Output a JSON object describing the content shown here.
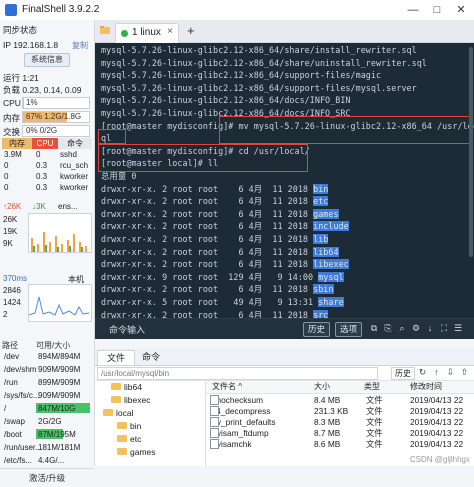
{
  "app": {
    "title": "FinalShell 3.9.2.2",
    "window_buttons": [
      "—",
      "□",
      "✕"
    ]
  },
  "sidebar": {
    "sync_status": "同步状态",
    "ip_label": "IP 192.168.1.8",
    "copy_label": "复制",
    "sysinfo_button": "系统信息",
    "uptime": "运行 1:21",
    "load": "负载 0.23, 0.14, 0.09",
    "cpu": {
      "label": "CPU",
      "text": "1%",
      "percent": 1
    },
    "mem": {
      "label": "内存",
      "text": "67%   1.2G/1.8G",
      "percent": 67
    },
    "swap": {
      "label": "交换",
      "text": "0%   0/2G",
      "percent": 0
    },
    "proc_headers": [
      "内存",
      "CPU",
      "命令"
    ],
    "processes": [
      {
        "mem": "3.9M",
        "cpu": "0",
        "cmd": "sshd"
      },
      {
        "mem": "0",
        "cpu": "0.3",
        "cmd": "rcu_sch"
      },
      {
        "mem": "0",
        "cpu": "0.3",
        "cmd": "kworker"
      },
      {
        "mem": "0",
        "cpu": "0.3",
        "cmd": "kworker"
      }
    ],
    "net": {
      "up": "↑26K",
      "down": "↓3K",
      "iface": "ens...",
      "scale": [
        "26K",
        "19K",
        "9K"
      ]
    },
    "latency": {
      "label": "370ms",
      "host": "本机",
      "scale": [
        "2846",
        "1424",
        "2"
      ]
    },
    "disk_headers": [
      "路径",
      "可用/大小"
    ],
    "disks": [
      {
        "path": "/dev",
        "size": "894M/894M"
      },
      {
        "path": "/dev/shm",
        "size": "909M/909M"
      },
      {
        "path": "/run",
        "size": "899M/909M"
      },
      {
        "path": "/sys/fs/c...",
        "size": "909M/909M"
      },
      {
        "path": "/",
        "size": "847M/10G"
      },
      {
        "path": "/swap",
        "size": "2G/2G"
      },
      {
        "path": "/boot",
        "size": "87M/195M"
      },
      {
        "path": "/run/user...",
        "size": "181M/181M"
      },
      {
        "path": "/etc/fs...",
        "size": "4.4G/..."
      }
    ],
    "upgrade": "激活/升级"
  },
  "tabs": [
    {
      "label": "1 linux"
    }
  ],
  "terminal": {
    "lines": [
      "mysql-5.7.26-linux-glibc2.12-x86_64/share/install_rewriter.sql",
      "mysql-5.7.26-linux-glibc2.12-x86_64/share/uninstall_rewriter.sql",
      "mysql-5.7.26-linux-glibc2.12-x86_64/support-files/magic",
      "mysql-5.7.26-linux-glibc2.12-x86_64/support-files/mysql.server",
      "mysql-5.7.26-linux-glibc2.12-x86_64/docs/INFO_BIN",
      "mysql-5.7.26-linux-glibc2.12-x86_64/docs/INFO_SRC",
      "[root@master mydisconfig]# mv mysql-5.7.26-linux-glibc2.12-x86_64 /usr/local/mys",
      "ql",
      "[root@master mydisconfig]# cd /usr/local/",
      "[root@master local]# ll",
      "总用量 0"
    ],
    "listing": [
      {
        "perm": "drwxr-xr-x. 2 root root    6 4月  11 2018",
        "name": "bin"
      },
      {
        "perm": "drwxr-xr-x. 2 root root    6 4月  11 2018",
        "name": "etc"
      },
      {
        "perm": "drwxr-xr-x. 2 root root    6 4月  11 2018",
        "name": "games"
      },
      {
        "perm": "drwxr-xr-x. 2 root root    6 4月  11 2018",
        "name": "include"
      },
      {
        "perm": "drwxr-xr-x. 2 root root    6 4月  11 2018",
        "name": "lib"
      },
      {
        "perm": "drwxr-xr-x. 2 root root    6 4月  11 2018",
        "name": "lib64"
      },
      {
        "perm": "drwxr-xr-x. 2 root root    6 4月  11 2018",
        "name": "libexec"
      },
      {
        "perm": "drwxr-xr-x. 9 root root  129 4月   9 14:00",
        "name": "mysql"
      },
      {
        "perm": "drwxr-xr-x. 2 root root    6 4月  11 2018",
        "name": "sbin"
      },
      {
        "perm": "drwxr-xr-x. 5 root root   49 4月   9 13:31",
        "name": "share"
      },
      {
        "perm": "drwxr-xr-x. 2 root root    6 4月  11 2018",
        "name": "src"
      }
    ],
    "prompt_end": "[root@master local]# "
  },
  "cmdbar": {
    "label": "命令输入",
    "history": "历史",
    "options": "选项"
  },
  "filepane": {
    "tabs": [
      "文件",
      "命令"
    ],
    "path": "/usr/local/mysql/bin",
    "history_btn": "历史",
    "tree": [
      "lib64",
      "libexec",
      "local",
      "bin",
      "etc",
      "games"
    ],
    "headers": [
      "文件名 ^",
      "大小",
      "类型",
      "修改时间"
    ],
    "files": [
      {
        "name": "innochecksum",
        "size": "8.4 MB",
        "type": "文件",
        "date": "2019/04/13 22"
      },
      {
        "name": "lz4_decompress",
        "size": "231.3 KB",
        "type": "文件",
        "date": "2019/04/13 22"
      },
      {
        "name": "my_print_defaults",
        "size": "8.3 MB",
        "type": "文件",
        "date": "2019/04/13 22"
      },
      {
        "name": "myisam_ftdump",
        "size": "8.7 MB",
        "type": "文件",
        "date": "2019/04/13 22"
      },
      {
        "name": "myisamchk",
        "size": "8.6 MB",
        "type": "文件",
        "date": "2019/04/13 22"
      }
    ],
    "watermark": "CSDN @gljlhhgx"
  },
  "colors": {
    "mem_fill": "#f0b86b",
    "cpu_fill": "#9fd0f0",
    "dir_blue": "#3f7bd6",
    "highlight": "#e2433a"
  }
}
